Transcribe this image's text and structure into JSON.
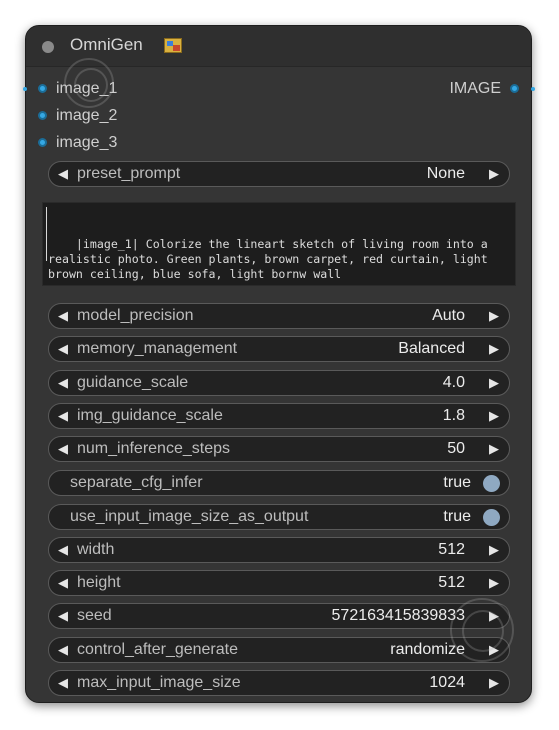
{
  "node": {
    "title": "OmniGen",
    "title_icon": "picture-emoji-icon"
  },
  "inputs": [
    {
      "label": "image_1"
    },
    {
      "label": "image_2"
    },
    {
      "label": "image_3"
    }
  ],
  "output": {
    "label": "IMAGE"
  },
  "widgets": {
    "preset_prompt": {
      "label": "preset_prompt",
      "value": "None"
    },
    "prompt_text": "|image_1| Colorize the lineart sketch of living room into a realistic photo. Green plants, brown carpet, red curtain, light brown ceiling, blue sofa, light bornw wall",
    "model_precision": {
      "label": "model_precision",
      "value": "Auto"
    },
    "memory_management": {
      "label": "memory_management",
      "value": "Balanced"
    },
    "guidance_scale": {
      "label": "guidance_scale",
      "value": "4.0"
    },
    "img_guidance_scale": {
      "label": "img_guidance_scale",
      "value": "1.8"
    },
    "num_inference_steps": {
      "label": "num_inference_steps",
      "value": "50"
    },
    "separate_cfg_infer": {
      "label": "separate_cfg_infer",
      "value": "true"
    },
    "use_input_image_size_as_output": {
      "label": "use_input_image_size_as_output",
      "value": "true"
    },
    "width": {
      "label": "width",
      "value": "512"
    },
    "height": {
      "label": "height",
      "value": "512"
    },
    "seed": {
      "label": "seed",
      "value": "572163415839833"
    },
    "control_after_generate": {
      "label": "control_after_generate",
      "value": "randomize"
    },
    "max_input_image_size": {
      "label": "max_input_image_size",
      "value": "1024"
    }
  },
  "colors": {
    "node_bg": "#353535",
    "slot_accent": "#35a8e4",
    "toggle_knob": "#8fa9c2"
  }
}
